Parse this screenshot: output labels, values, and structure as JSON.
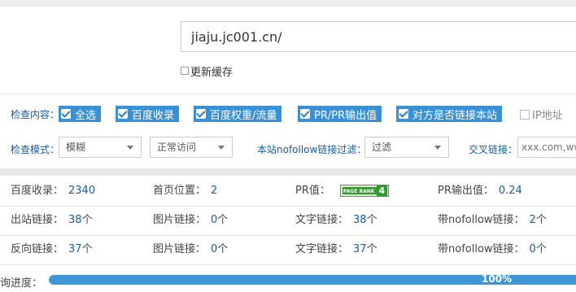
{
  "url": {
    "value": "jiaju.jc001.cn/"
  },
  "refresh_cache": {
    "label": "更新缓存",
    "checked": false
  },
  "check_content": {
    "label": "检查内容：",
    "options": [
      {
        "label": "全选",
        "checked": true
      },
      {
        "label": "百度收录",
        "checked": true
      },
      {
        "label": "百度权重/流量",
        "checked": true
      },
      {
        "label": "PR/PR输出值",
        "checked": true
      },
      {
        "label": "对方是否链接本站",
        "checked": true
      },
      {
        "label": "IP地址",
        "checked": false
      }
    ]
  },
  "check_mode": {
    "label": "检查模式：",
    "mode_value": "模糊",
    "access_value": "正常访问"
  },
  "nofollow_filter": {
    "label": "本站nofollow链接过滤：",
    "value": "过滤"
  },
  "cross_link": {
    "label": "交叉链接：",
    "placeholder": "xxx.com,www"
  },
  "stats": {
    "row1": {
      "baidu_index": {
        "label": "百度收录：",
        "value": "2340"
      },
      "home_position": {
        "label": "首页位置：",
        "value": "2"
      },
      "pr": {
        "label": "PR值：",
        "badge_text": "PAGE RANK",
        "value": "4"
      },
      "pr_output": {
        "label": "PR输出值：",
        "value": "0.24"
      }
    },
    "row2": {
      "outbound": {
        "label": "出站链接：",
        "value": "38",
        "unit": "个"
      },
      "image_links": {
        "label": "图片链接：",
        "value": "0",
        "unit": "个"
      },
      "text_links": {
        "label": "文字链接：",
        "value": "38",
        "unit": "个"
      },
      "nofollow_links": {
        "label": "带nofollow链接：",
        "value": "2",
        "unit": "个"
      }
    },
    "row3": {
      "backlinks": {
        "label": "反向链接：",
        "value": "37",
        "unit": "个"
      },
      "image_links": {
        "label": "图片链接：",
        "value": "0",
        "unit": "个"
      },
      "text_links": {
        "label": "文字链接：",
        "value": "37",
        "unit": "个"
      },
      "nofollow_links": {
        "label": "带nofollow链接：",
        "value": "0",
        "unit": "个"
      }
    }
  },
  "progress": {
    "label": "询进度：",
    "percent_text": "100%",
    "value": 1.0
  },
  "colors": {
    "accent": "#3a90d4",
    "link": "#1a5a9a",
    "progress": "#3f95d6"
  }
}
